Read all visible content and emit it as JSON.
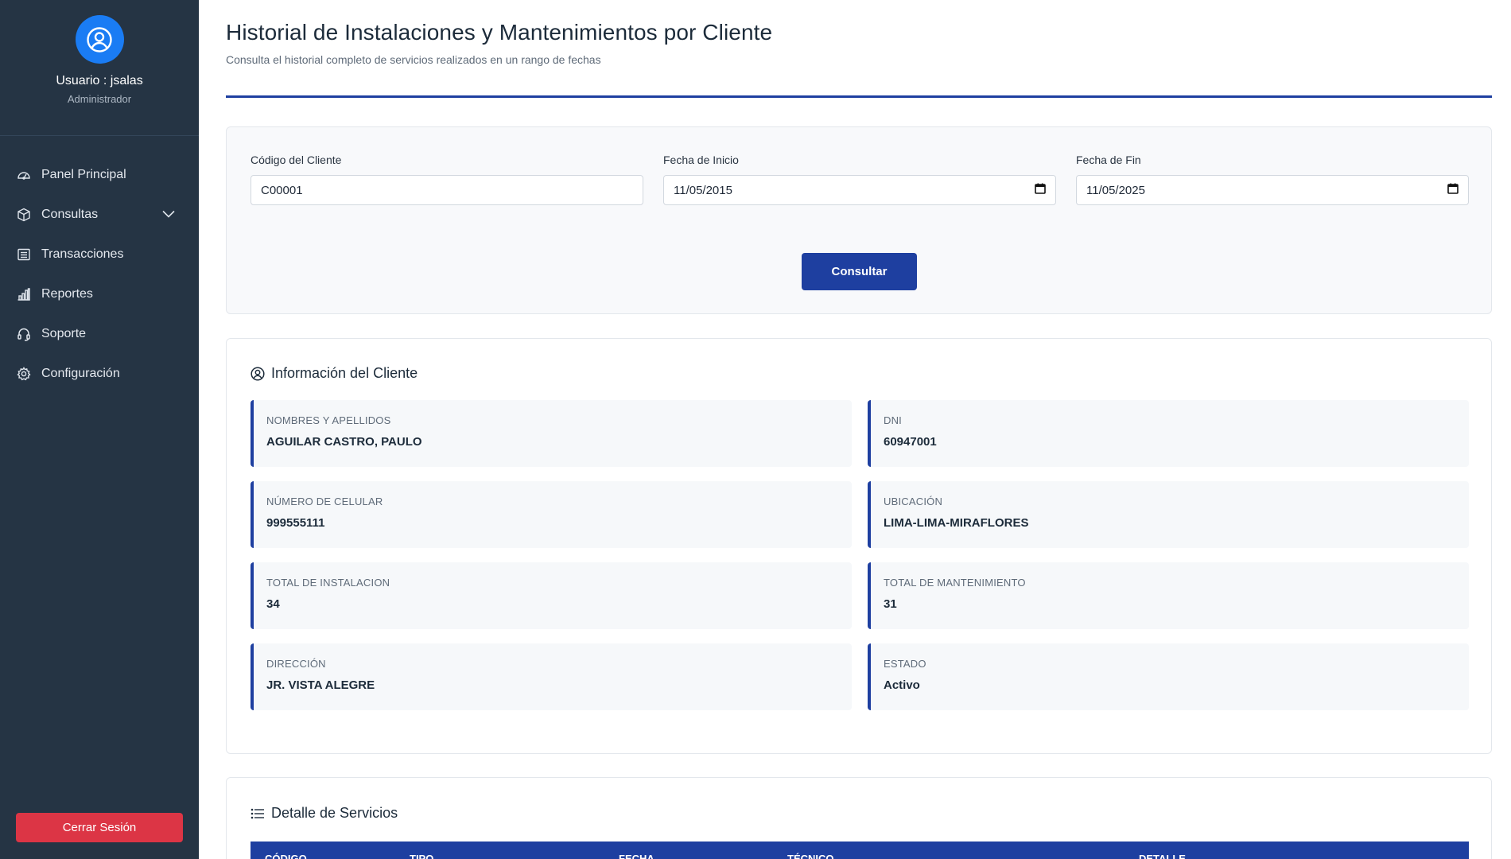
{
  "sidebar": {
    "user_label": "Usuario : jsalas",
    "role": "Administrador",
    "items": [
      {
        "label": "Panel Principal",
        "icon": "dashboard-icon"
      },
      {
        "label": "Consultas",
        "icon": "box-icon",
        "has_submenu": true
      },
      {
        "label": "Transacciones",
        "icon": "table-icon"
      },
      {
        "label": "Reportes",
        "icon": "bar-chart-icon"
      },
      {
        "label": "Soporte",
        "icon": "headset-icon"
      },
      {
        "label": "Configuración",
        "icon": "gear-icon"
      }
    ],
    "logout_label": "Cerrar Sesión"
  },
  "header": {
    "title": "Historial de Instalaciones y Mantenimientos por Cliente",
    "subtitle": "Consulta el historial completo de servicios realizados en un rango de fechas"
  },
  "filter": {
    "client_code_label": "Código del Cliente",
    "client_code_value": "C00001",
    "start_date_label": "Fecha de Inicio",
    "start_date_value": "11/05/2015",
    "end_date_label": "Fecha de Fin",
    "end_date_value": "11/05/2025",
    "submit_label": "Consultar"
  },
  "client_info": {
    "title": "Información del Cliente",
    "fields": [
      {
        "label": "Nombres y Apellidos",
        "value": "AGUILAR CASTRO, PAULO"
      },
      {
        "label": "DNI",
        "value": "60947001"
      },
      {
        "label": "Número de Celular",
        "value": "999555111"
      },
      {
        "label": "Ubicación",
        "value": "LIMA-LIMA-MIRAFLORES"
      },
      {
        "label": "Total de Instalacion",
        "value": "34"
      },
      {
        "label": "Total de Mantenimiento",
        "value": "31"
      },
      {
        "label": "Dirección",
        "value": "JR. VISTA ALEGRE"
      },
      {
        "label": "Estado",
        "value": "Activo"
      }
    ]
  },
  "services": {
    "title": "Detalle de Servicios",
    "columns": [
      "Código",
      "Tipo",
      "Fecha",
      "Técnico",
      "Detalle"
    ]
  },
  "colors": {
    "sidebar_bg": "#253444",
    "accent": "#1e3fa0",
    "avatar": "#1a7cf4",
    "logout": "#dc3545"
  }
}
